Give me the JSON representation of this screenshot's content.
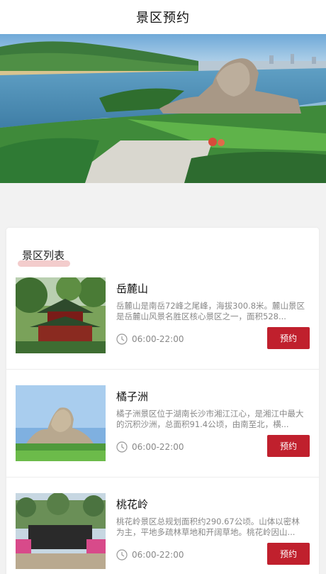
{
  "header": {
    "title": "景区预约"
  },
  "section": {
    "title": "景区列表"
  },
  "spots": [
    {
      "name": "岳麓山",
      "desc": "岳麓山是南岳72峰之尾峰，海拔300.8米。麓山景区是岳麓山风景名胜区核心景区之一，面积528...",
      "hours": "06:00-22:00",
      "button": "预约"
    },
    {
      "name": "橘子洲",
      "desc": "橘子洲景区位于湖南长沙市湘江江心，是湘江中最大的沉积沙洲，总面积91.4公顷，由南至北，横...",
      "hours": "06:00-22:00",
      "button": "预约"
    },
    {
      "name": "桃花岭",
      "desc": "桃花岭景区总规划面积约290.67公顷。山体以密林为主，平地多疏林草地和开阔草地。桃花岭因山...",
      "hours": "06:00-22:00",
      "button": "预约"
    }
  ],
  "colors": {
    "accent": "#c0202d",
    "underline": "#f3cccc"
  },
  "icons": {
    "clock": "clock-icon"
  }
}
